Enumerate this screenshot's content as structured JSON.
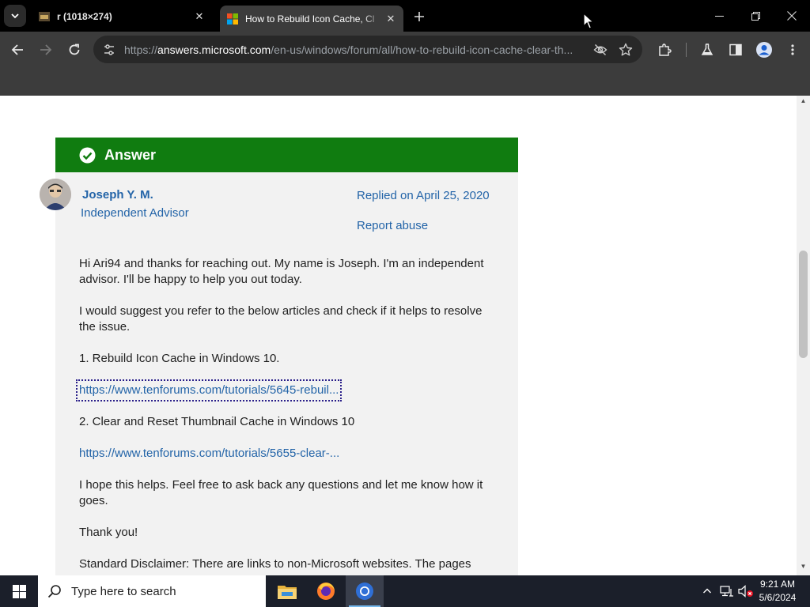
{
  "browser": {
    "tabs": [
      {
        "title": "r (1018×274)",
        "active": false,
        "close": "✕"
      },
      {
        "title": "How to Rebuild Icon Cache, Cl",
        "active": true,
        "close": "✕"
      }
    ],
    "new_tab": "+",
    "url": {
      "scheme": "https://",
      "host": "answers.microsoft.com",
      "path": "/en-us/windows/forum/all/how-to-rebuild-icon-cache-clear-th..."
    }
  },
  "answer": {
    "header": "Answer",
    "author": "Joseph Y. M.",
    "role": "Independent Advisor",
    "replied": "Replied on April 25, 2020",
    "report": "Report abuse",
    "paragraphs": [
      "Hi Ari94 and thanks for reaching out. My name is Joseph. I'm an independent advisor. I'll be happy to help you out today.",
      "I would suggest you refer to the below articles and check if it helps to resolve the issue.",
      "1. Rebuild Icon Cache in Windows 10.",
      "2. Clear and Reset Thumbnail Cache in Windows 10",
      "I hope this helps. Feel free to ask back any questions and let me know how it goes.",
      "Thank you!",
      "Standard Disclaimer: There are links to non-Microsoft websites. The pages"
    ],
    "links": [
      "https://www.tenforums.com/tutorials/5645-rebuil...",
      "https://www.tenforums.com/tutorials/5655-clear-..."
    ]
  },
  "taskbar": {
    "search_placeholder": "Type here to search",
    "time": "9:21 AM",
    "date": "5/6/2024",
    "apps": [
      "file-explorer",
      "firefox",
      "chrome"
    ]
  },
  "colors": {
    "answer_green": "#107c10",
    "link_blue": "#2364a8",
    "card_bg": "#f2f2f2"
  }
}
